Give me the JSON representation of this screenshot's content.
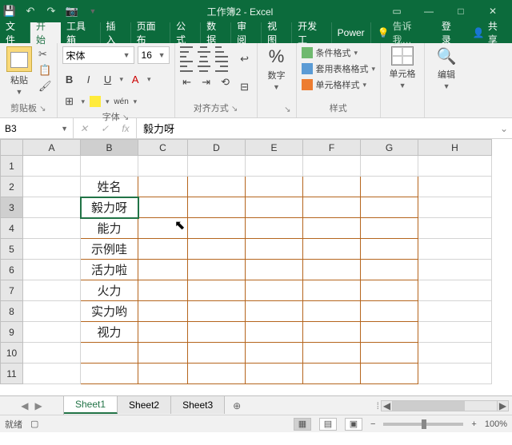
{
  "title": "工作簿2 - Excel",
  "menu": {
    "file": "文件",
    "home": "开始",
    "toolbox": "工具箱",
    "insert": "插入",
    "layout": "页面布",
    "formula": "公式",
    "data": "数据",
    "review": "审阅",
    "view": "视图",
    "dev": "开发工",
    "power": "Power",
    "tell": "告诉我…",
    "login": "登录",
    "share": "共享"
  },
  "ribbon": {
    "clipboard": {
      "paste": "粘贴",
      "label": "剪贴板"
    },
    "font": {
      "name": "宋体",
      "size": "16",
      "label": "字体",
      "pinyin": "wén"
    },
    "align": {
      "label": "对齐方式"
    },
    "number": {
      "sym": "%",
      "label": "数字"
    },
    "styles": {
      "cond": "条件格式",
      "tbl": "套用表格格式",
      "cell": "单元格样式",
      "label": "样式"
    },
    "cells": {
      "label": "单元格"
    },
    "edit": {
      "label": "编辑"
    }
  },
  "formula_bar": {
    "ref": "B3",
    "value": "毅力呀"
  },
  "cols": [
    "A",
    "B",
    "C",
    "D",
    "E",
    "F",
    "G",
    "H"
  ],
  "rows": [
    "1",
    "2",
    "3",
    "4",
    "5",
    "6",
    "7",
    "8",
    "9",
    "10",
    "11"
  ],
  "cells": {
    "b2": "姓名",
    "b3": "毅力呀",
    "b4": "能力",
    "b5": "示例哇",
    "b6": "活力啦",
    "b7": "火力",
    "b8": "实力哟",
    "b9": "视力"
  },
  "sheets": {
    "s1": "Sheet1",
    "s2": "Sheet2",
    "s3": "Sheet3"
  },
  "status": {
    "ready": "就绪",
    "zoom": "100%"
  }
}
